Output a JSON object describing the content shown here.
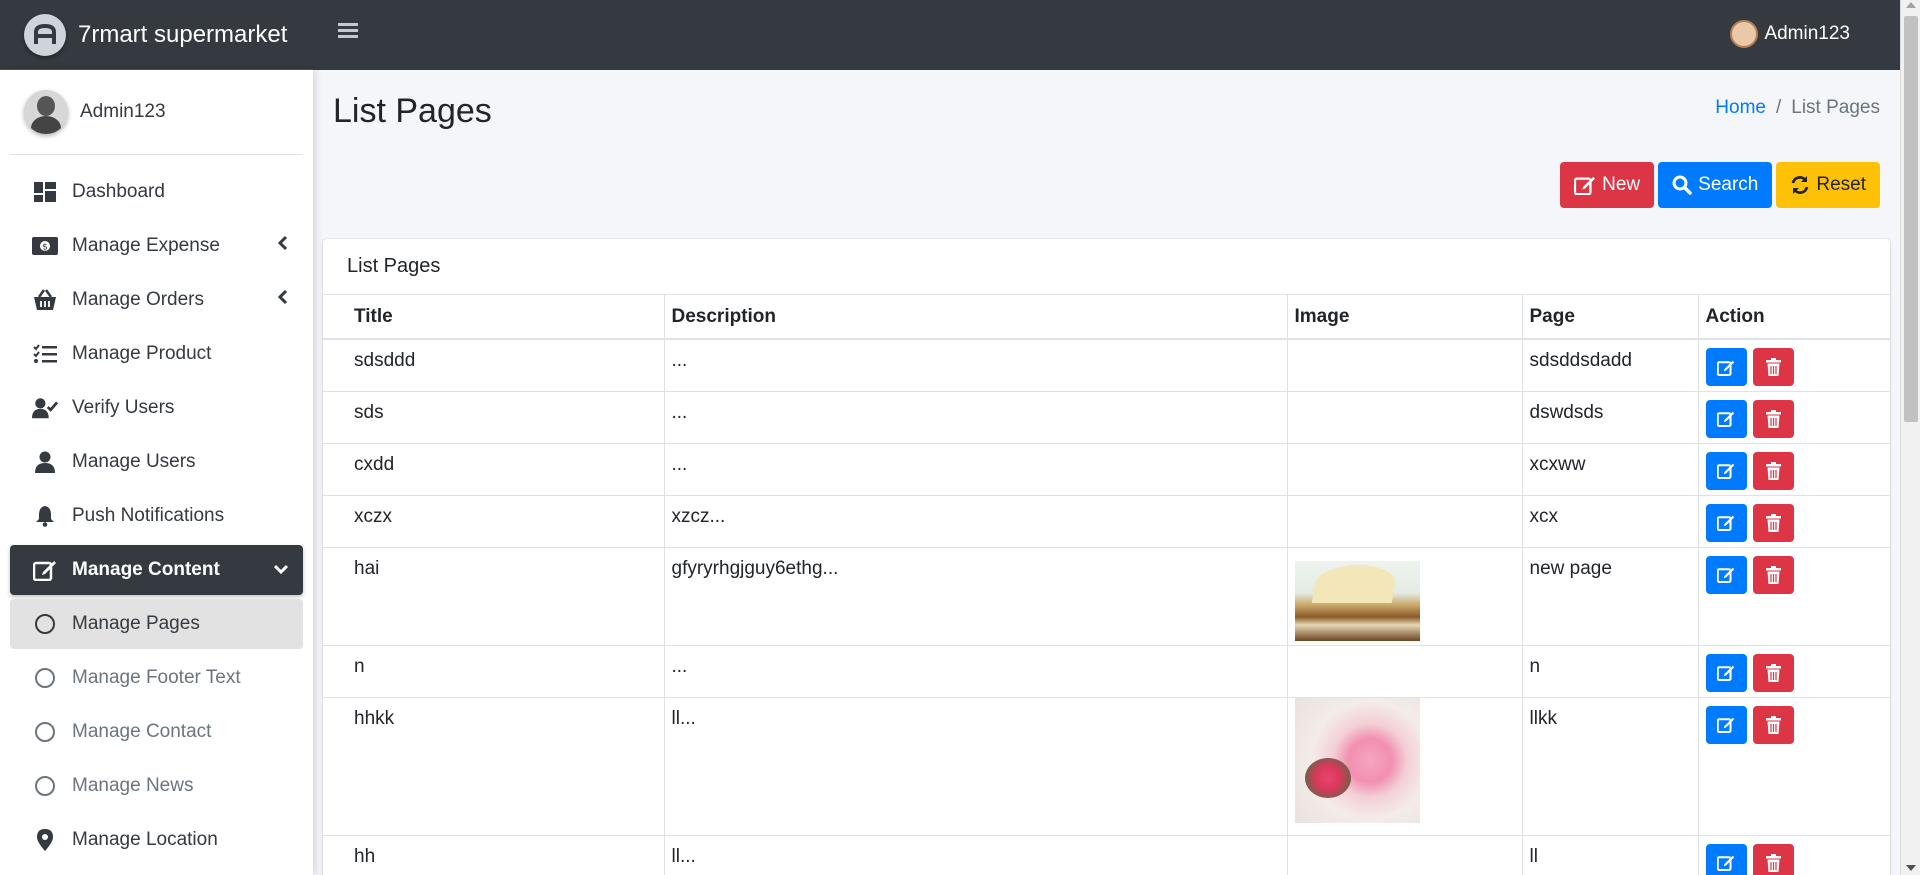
{
  "app": {
    "brand": "7rmart supermarket",
    "user": "Admin123"
  },
  "sidebar": {
    "user": "Admin123",
    "items": [
      {
        "label": "Dashboard",
        "icon": "dashboard-icon"
      },
      {
        "label": "Manage Expense",
        "icon": "money-icon",
        "chevron": "left"
      },
      {
        "label": "Manage Orders",
        "icon": "basket-icon",
        "chevron": "left"
      },
      {
        "label": "Manage Product",
        "icon": "tasks-icon"
      },
      {
        "label": "Verify Users",
        "icon": "user-check-icon"
      },
      {
        "label": "Manage Users",
        "icon": "user-icon"
      },
      {
        "label": "Push Notifications",
        "icon": "bell-icon"
      },
      {
        "label": "Manage Content",
        "icon": "edit-icon",
        "chevron": "down",
        "active": true
      }
    ],
    "sub_items": [
      {
        "label": "Manage Pages",
        "current": true
      },
      {
        "label": "Manage Footer Text"
      },
      {
        "label": "Manage Contact"
      },
      {
        "label": "Manage News"
      }
    ],
    "location": {
      "label": "Manage Location",
      "icon": "map-marker-icon"
    }
  },
  "page": {
    "title": "List Pages",
    "breadcrumb": {
      "home": "Home",
      "sep": "/",
      "current": "List Pages"
    },
    "buttons": {
      "new": "New",
      "search": "Search",
      "reset": "Reset"
    }
  },
  "card": {
    "title": "List Pages",
    "columns": [
      "Title",
      "Description",
      "Image",
      "Page",
      "Action"
    ],
    "rows": [
      {
        "title": "sdsddd",
        "description": "...",
        "image": "",
        "page": "sdsddsdadd"
      },
      {
        "title": "sds",
        "description": "...",
        "image": "",
        "page": "dswdsds"
      },
      {
        "title": "cxdd",
        "description": "...",
        "image": "",
        "page": "xcxww"
      },
      {
        "title": "xczx",
        "description": "xzcz...",
        "image": "",
        "page": "xcx"
      },
      {
        "title": "hai",
        "description": "gfyryrhgjguy6ethg...",
        "image": "books",
        "page": "new page"
      },
      {
        "title": "n",
        "description": "...",
        "image": "",
        "page": "n"
      },
      {
        "title": "hhkk",
        "description": "ll...",
        "image": "teddy-bear",
        "page": "llkk"
      },
      {
        "title": "hh",
        "description": "ll...",
        "image": "",
        "page": "ll"
      }
    ]
  },
  "colors": {
    "navbar": "#343a40",
    "primary": "#007bff",
    "danger": "#dc3545",
    "warning": "#ffc107"
  }
}
